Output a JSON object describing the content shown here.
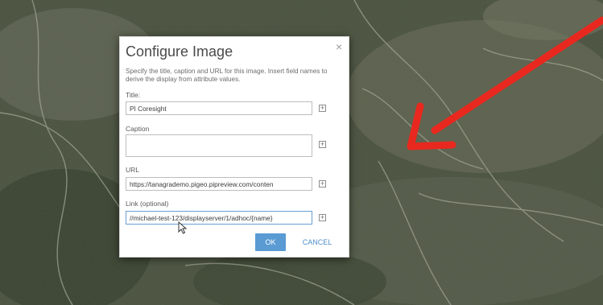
{
  "dialog": {
    "title": "Configure Image",
    "close_glyph": "×",
    "description": "Specify the title, caption and URL for this image. Insert field names to derive the display from attribute values.",
    "fields": [
      {
        "label": "Title:",
        "value": "PI Coresight"
      },
      {
        "label": "Caption",
        "value": ""
      },
      {
        "label": "URL",
        "value": "https://tanagrademo.pigeo.pipreview.com/conten"
      },
      {
        "label": "Link (optional)",
        "value": "//michael-test-123/displayserver/1/adhoc/{name}"
      }
    ],
    "add_glyph": "+",
    "ok_label": "OK",
    "cancel_label": "CANCEL"
  },
  "colors": {
    "annotation_arrow": "#e8281e",
    "ok_button": "#5a9bd3",
    "cancel_text": "#4f8ec9"
  },
  "icons": [
    "close-icon",
    "insert-field-icon",
    "mouse-cursor-icon",
    "annotation-arrow"
  ]
}
